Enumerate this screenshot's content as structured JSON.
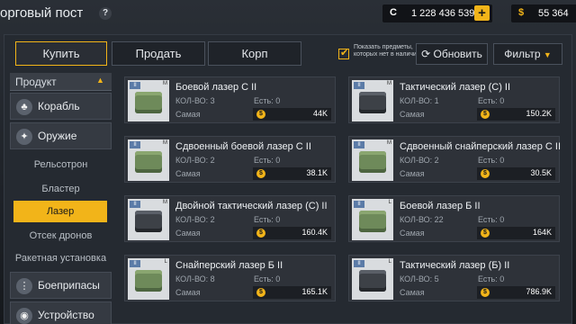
{
  "header": {
    "title": "орговый пост",
    "help_label": "?",
    "credits_symbol": "C",
    "credits_value": "1 228 436 539",
    "add_label": "+",
    "money_symbol": "$",
    "money_value": "55 364"
  },
  "tabs": [
    {
      "label": "Купить"
    },
    {
      "label": "Продать"
    },
    {
      "label": "Корп"
    }
  ],
  "options": {
    "hide_unavailable_label": "Показать предметы, которых нет в наличии",
    "checked_mark": "✔",
    "refresh_label": "Обновить",
    "filter_label": "Фильтр",
    "filter_caret": "▼"
  },
  "sidebar": {
    "header": "Продукт",
    "header_caret": "▲",
    "categories": [
      {
        "label": "Корабль",
        "icon": "ship-icon",
        "glyph": "♣"
      },
      {
        "label": "Оружие",
        "icon": "weapon-icon",
        "glyph": "✦"
      }
    ],
    "weapon_types": [
      {
        "label": "Рельсотрон"
      },
      {
        "label": "Бластер"
      },
      {
        "label": "Лазер"
      },
      {
        "label": "Отсек дронов"
      },
      {
        "label": "Ракетная установка"
      }
    ],
    "categories_bottom": [
      {
        "label": "Боеприпасы",
        "icon": "ammo-icon",
        "glyph": "⋮"
      },
      {
        "label": "Устройство",
        "icon": "device-icon",
        "glyph": "◉"
      }
    ]
  },
  "item_labels": {
    "qty": "КОЛ-ВО:",
    "have": "Есть:",
    "lowest": "Самая",
    "coin": "$"
  },
  "items": [
    {
      "name": "Боевой лазер С II",
      "tier": "II",
      "size": "M",
      "qty": "3",
      "have": "0",
      "price": "44K",
      "style": "green"
    },
    {
      "name": "Тактический лазер (С) II",
      "tier": "II",
      "size": "M",
      "qty": "1",
      "have": "0",
      "price": "150.2K",
      "style": "dark"
    },
    {
      "name": "Сдвоенный боевой лазер С II",
      "tier": "II",
      "size": "M",
      "qty": "2",
      "have": "0",
      "price": "38.1K",
      "style": "green"
    },
    {
      "name": "Сдвоенный снайперский лазер С II",
      "tier": "II",
      "size": "M",
      "qty": "2",
      "have": "0",
      "price": "30.5K",
      "style": "green"
    },
    {
      "name": "Двойной тактический лазер (С) II",
      "tier": "II",
      "size": "M",
      "qty": "2",
      "have": "0",
      "price": "160.4K",
      "style": "dark"
    },
    {
      "name": "Боевой лазер Б II",
      "tier": "II",
      "size": "L",
      "qty": "22",
      "have": "0",
      "price": "164K",
      "style": "green"
    },
    {
      "name": "Снайперский лазер Б II",
      "tier": "II",
      "size": "L",
      "qty": "8",
      "have": "0",
      "price": "165.1K",
      "style": "green"
    },
    {
      "name": "Тактический лазер (Б) II",
      "tier": "II",
      "size": "L",
      "qty": "5",
      "have": "0",
      "price": "786.9K",
      "style": "dark"
    }
  ]
}
